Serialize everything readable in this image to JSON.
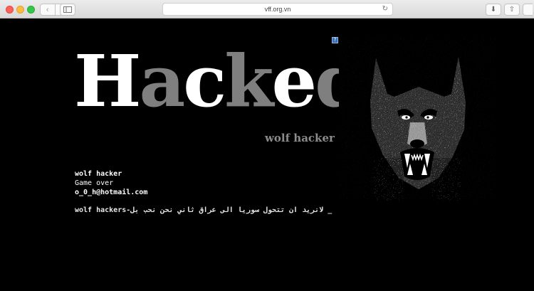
{
  "browser": {
    "url": "vff.org.vn",
    "nav_back_glyph": "‹",
    "nav_forward_glyph": "›",
    "reload_glyph": "↻",
    "download_glyph": "⬇",
    "share_glyph": "⇧"
  },
  "page": {
    "headline_parts": [
      "H",
      "a",
      "c",
      "k",
      "e",
      "d"
    ],
    "headline_colors": [
      "#ffffff",
      "#7f7f7f",
      "#ffffff",
      "#7f7f7f",
      "#ffffff",
      "#7f7f7f"
    ],
    "subtitle": "wolf hacker",
    "info_name": "wolf hacker",
    "info_status": "Game over",
    "info_email": "o_0_h@hotmail.com",
    "message": "wolf hackers-لانريد ان تتحول سوريا الى عراق ثاني نحن نحب بل _",
    "broken_image_glyph": "?"
  }
}
